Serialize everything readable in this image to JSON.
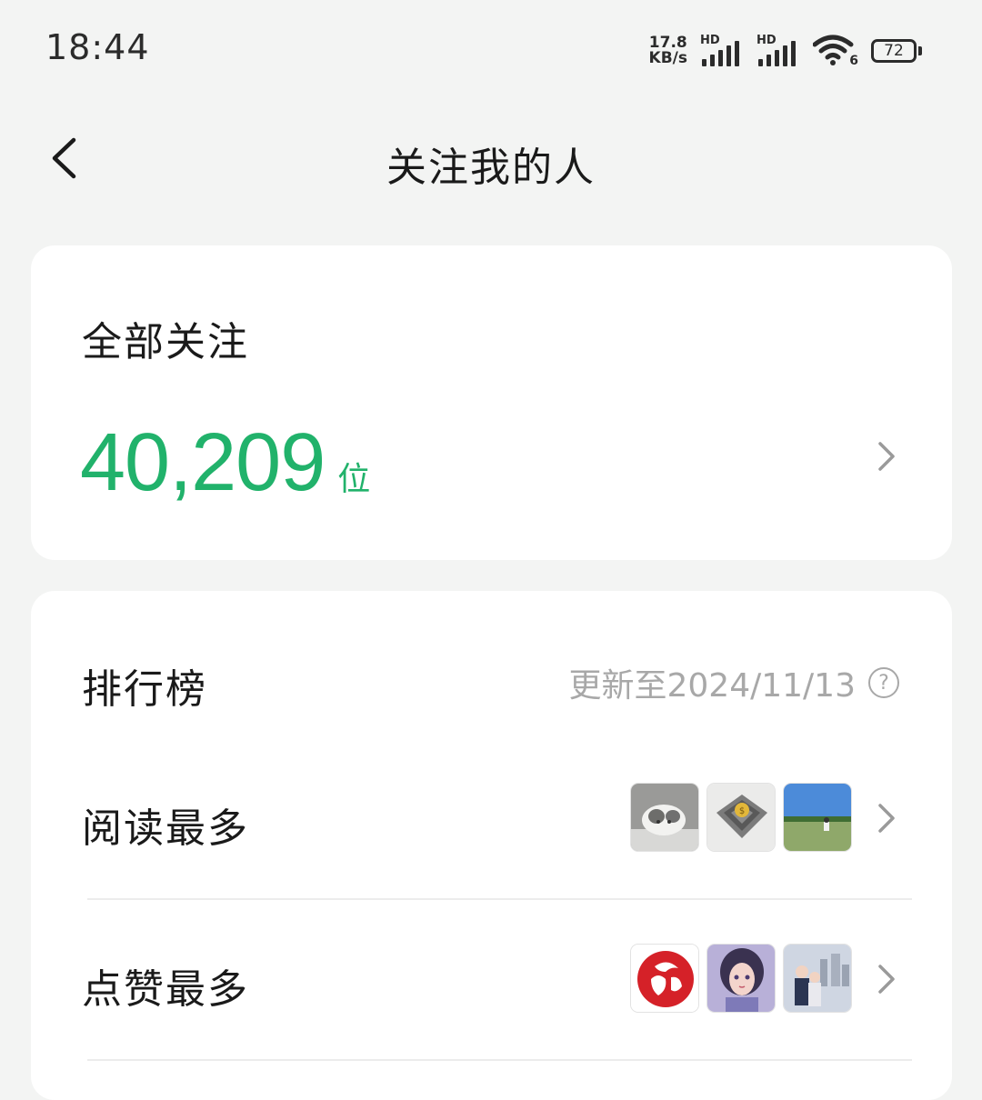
{
  "status_bar": {
    "time": "18:44",
    "net_speed_value": "17.8",
    "net_speed_unit": "KB/s",
    "signal1_label": "HD",
    "signal2_label": "HD",
    "wifi_label": "6",
    "battery_level": "72"
  },
  "header": {
    "title": "关注我的人"
  },
  "followers": {
    "label": "全部关注",
    "count": "40,209",
    "unit": "位"
  },
  "ranking": {
    "title": "排行榜",
    "updated": "更新至2024/11/13",
    "help": "?",
    "rows": [
      {
        "label": "阅读最多",
        "thumbs": [
          "gray-cat-avatar",
          "gold-coin-maze-avatar",
          "field-person-avatar"
        ]
      },
      {
        "label": "点赞最多",
        "thumbs": [
          "red-logo-avatar",
          "anime-girl-avatar",
          "couple-city-avatar"
        ]
      }
    ]
  },
  "colors": {
    "accent": "#21b26b",
    "background": "#f3f4f3",
    "card": "#ffffff",
    "muted": "#a8a8a8"
  }
}
